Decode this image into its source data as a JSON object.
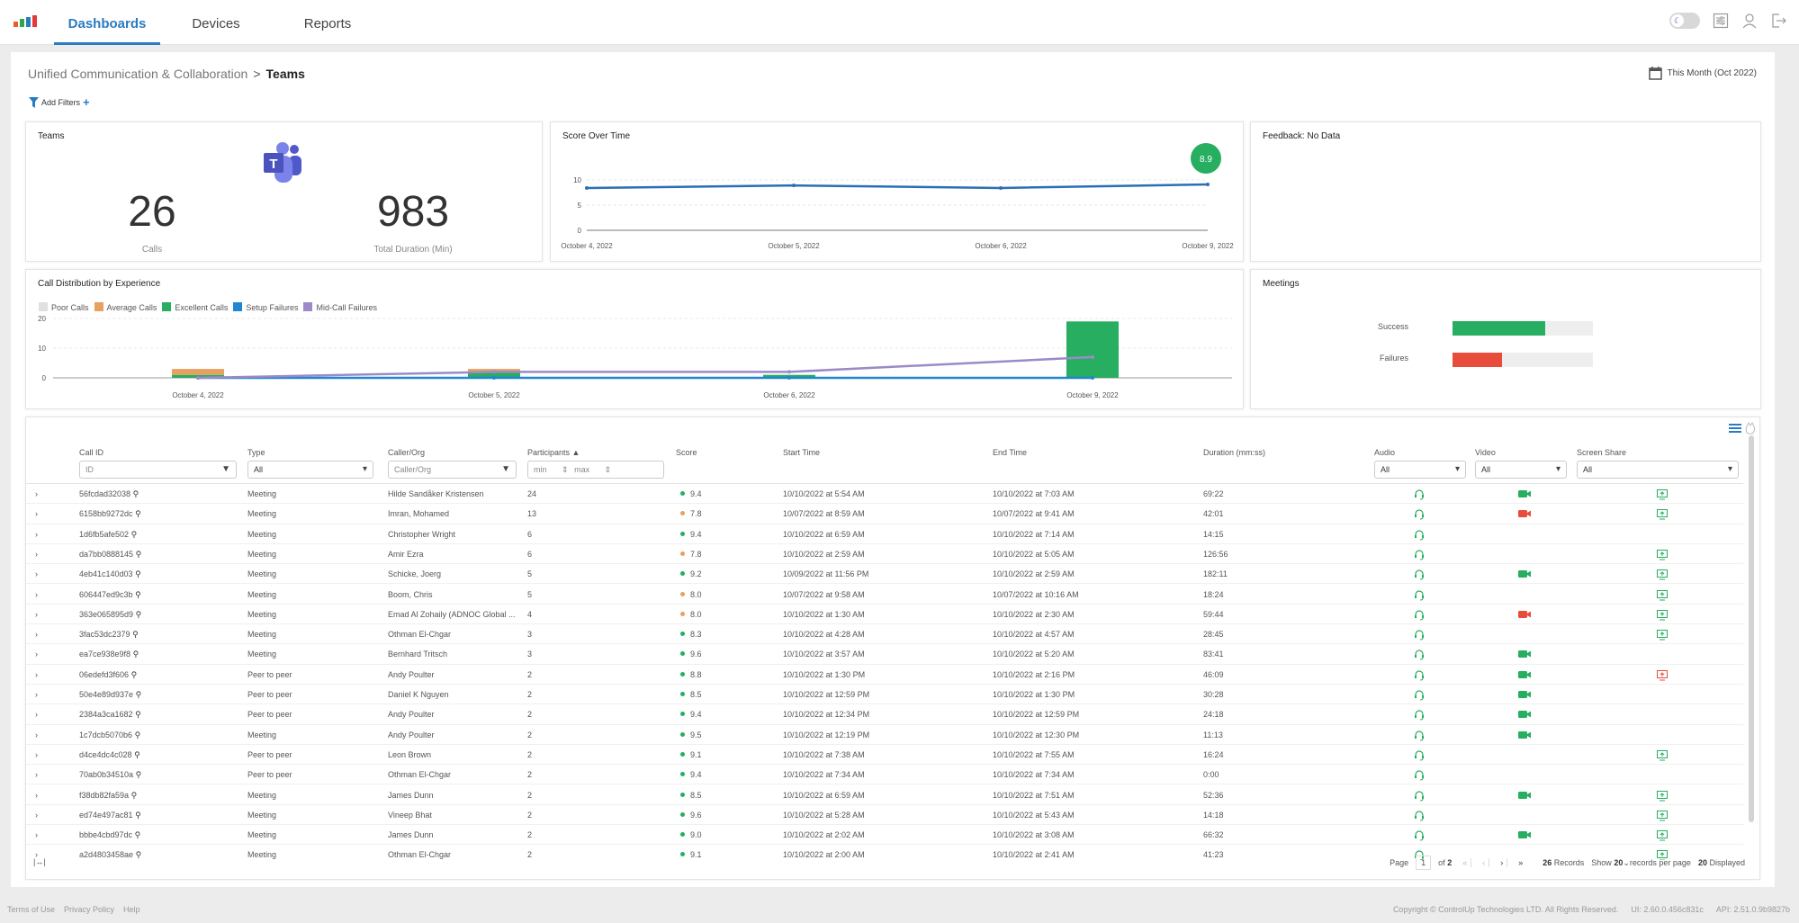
{
  "nav": {
    "tabs": [
      {
        "label": "Dashboards",
        "active": true
      },
      {
        "label": "Devices",
        "active": false
      },
      {
        "label": "Reports",
        "active": false
      }
    ],
    "icons": [
      "theme-toggle",
      "settings-sliders-icon",
      "user-icon",
      "logout-icon"
    ]
  },
  "breadcrumb": {
    "parent": "Unified Communication & Collaboration",
    "separator": ">",
    "current": "Teams"
  },
  "filters": {
    "add_label": "Add Filters",
    "add_icon": "+"
  },
  "date_range": "This Month (Oct 2022)",
  "teams_card": {
    "title": "Teams",
    "calls_value": "26",
    "calls_label": "Calls",
    "duration_value": "983",
    "duration_label": "Total Duration (Min)"
  },
  "score_card": {
    "title": "Score Over Time",
    "badge": "8.9",
    "badge_color": "#27ae60",
    "line_color": "#2a6fb5"
  },
  "feedback_card": {
    "title": "Feedback: No Data"
  },
  "distribution_card": {
    "title": "Call Distribution by Experience"
  },
  "meetings_card": {
    "title": "Meetings",
    "bars": [
      {
        "label": "Success",
        "fraction": 0.66,
        "color": "#27ae60"
      },
      {
        "label": "Failures",
        "fraction": 0.35,
        "color": "#e74c3c"
      }
    ]
  },
  "chart_data": [
    {
      "type": "line",
      "title": "Score Over Time",
      "x": [
        "October 4, 2022",
        "October 5, 2022",
        "October 6, 2022",
        "October 9, 2022"
      ],
      "series": [
        {
          "name": "Score",
          "values": [
            8.4,
            8.9,
            8.4,
            9.1
          ]
        }
      ],
      "ylim": [
        0,
        10
      ],
      "yticks": [
        0,
        5,
        10
      ],
      "grid": true,
      "annotation": "8.9"
    },
    {
      "type": "bar",
      "title": "Call Distribution by Experience",
      "categories": [
        "October 4, 2022",
        "October 5, 2022",
        "October 6, 2022",
        "October 9, 2022"
      ],
      "series": [
        {
          "name": "Poor Calls",
          "kind": "bar",
          "color": "#e0e0e0",
          "values": [
            0,
            0,
            0,
            0
          ]
        },
        {
          "name": "Average Calls",
          "kind": "bar",
          "color": "#e8a060",
          "values": [
            2,
            1,
            0,
            0
          ]
        },
        {
          "name": "Excellent Calls",
          "kind": "bar",
          "color": "#27ae60",
          "values": [
            1,
            2,
            1,
            19
          ]
        },
        {
          "name": "Setup Failures",
          "kind": "line",
          "color": "#1f86d1",
          "values": [
            0,
            0,
            0,
            0
          ]
        },
        {
          "name": "Mid-Call Failures",
          "kind": "line",
          "color": "#9b8ac7",
          "values": [
            0,
            2,
            2,
            7
          ]
        }
      ],
      "ylim": [
        0,
        20
      ],
      "yticks": [
        0,
        10,
        20
      ],
      "legend": "top-left",
      "grid": true
    }
  ],
  "table": {
    "columns": {
      "call_id": "Call ID",
      "type": "Type",
      "caller": "Caller/Org",
      "participants": "Participants ▲",
      "score": "Score",
      "start": "Start Time",
      "end": "End Time",
      "duration": "Duration (mm:ss)",
      "audio": "Audio",
      "video": "Video",
      "screen": "Screen Share"
    },
    "filters": {
      "call_id_placeholder": "ID",
      "type_value": "All",
      "caller_placeholder": "Caller/Org",
      "min_placeholder": "min",
      "max_placeholder": "max",
      "audio_value": "All",
      "video_value": "All",
      "screen_value": "All"
    },
    "rows": [
      {
        "id": "56fcdad32038",
        "type": "Meeting",
        "caller": "Hilde Sandåker Kristensen",
        "participants": "24",
        "score": "9.4",
        "score_color": "#27ae60",
        "start": "10/10/2022 at 5:54 AM",
        "end": "10/10/2022 at 7:03 AM",
        "duration": "69:22",
        "audio": "green",
        "video": "green",
        "screen": "green"
      },
      {
        "id": "6158bb9272dc",
        "type": "Meeting",
        "caller": "Imran, Mohamed",
        "participants": "13",
        "score": "7.8",
        "score_color": "#e8a060",
        "start": "10/07/2022 at 8:59 AM",
        "end": "10/07/2022 at 9:41 AM",
        "duration": "42:01",
        "audio": "green",
        "video": "red",
        "screen": "green"
      },
      {
        "id": "1d6fb5afe502",
        "type": "Meeting",
        "caller": "Christopher Wright",
        "participants": "6",
        "score": "9.4",
        "score_color": "#27ae60",
        "start": "10/10/2022 at 6:59 AM",
        "end": "10/10/2022 at 7:14 AM",
        "duration": "14:15",
        "audio": "green",
        "video": "",
        "screen": ""
      },
      {
        "id": "da7bb0888145",
        "type": "Meeting",
        "caller": "Amir Ezra",
        "participants": "6",
        "score": "7.8",
        "score_color": "#e8a060",
        "start": "10/10/2022 at 2:59 AM",
        "end": "10/10/2022 at 5:05 AM",
        "duration": "126:56",
        "audio": "green",
        "video": "",
        "screen": "green"
      },
      {
        "id": "4eb41c140d03",
        "type": "Meeting",
        "caller": "Schicke, Joerg",
        "participants": "5",
        "score": "9.2",
        "score_color": "#27ae60",
        "start": "10/09/2022 at 11:56 PM",
        "end": "10/10/2022 at 2:59 AM",
        "duration": "182:11",
        "audio": "green",
        "video": "green",
        "screen": "green"
      },
      {
        "id": "606447ed9c3b",
        "type": "Meeting",
        "caller": "Boom, Chris",
        "participants": "5",
        "score": "8.0",
        "score_color": "#e8a060",
        "start": "10/07/2022 at 9:58 AM",
        "end": "10/07/2022 at 10:16 AM",
        "duration": "18:24",
        "audio": "green",
        "video": "",
        "screen": "green"
      },
      {
        "id": "363e065895d9",
        "type": "Meeting",
        "caller": "Emad Al Zohaily (ADNOC Global ...",
        "participants": "4",
        "score": "8.0",
        "score_color": "#e8a060",
        "start": "10/10/2022 at 1:30 AM",
        "end": "10/10/2022 at 2:30 AM",
        "duration": "59:44",
        "audio": "green",
        "video": "red",
        "screen": "green"
      },
      {
        "id": "3fac53dc2379",
        "type": "Meeting",
        "caller": "Othman El-Chgar",
        "participants": "3",
        "score": "8.3",
        "score_color": "#27ae60",
        "start": "10/10/2022 at 4:28 AM",
        "end": "10/10/2022 at 4:57 AM",
        "duration": "28:45",
        "audio": "green",
        "video": "",
        "screen": "green"
      },
      {
        "id": "ea7ce938e9f8",
        "type": "Meeting",
        "caller": "Bernhard Tritsch",
        "participants": "3",
        "score": "9.6",
        "score_color": "#27ae60",
        "start": "10/10/2022 at 3:57 AM",
        "end": "10/10/2022 at 5:20 AM",
        "duration": "83:41",
        "audio": "green",
        "video": "green",
        "screen": ""
      },
      {
        "id": "06edefd3f606",
        "type": "Peer to peer",
        "caller": "Andy Poulter",
        "participants": "2",
        "score": "8.8",
        "score_color": "#27ae60",
        "start": "10/10/2022 at 1:30 PM",
        "end": "10/10/2022 at 2:16 PM",
        "duration": "46:09",
        "audio": "green",
        "video": "green",
        "screen": "red"
      },
      {
        "id": "50e4e89d937e",
        "type": "Peer to peer",
        "caller": "Daniel K Nguyen",
        "participants": "2",
        "score": "8.5",
        "score_color": "#27ae60",
        "start": "10/10/2022 at 12:59 PM",
        "end": "10/10/2022 at 1:30 PM",
        "duration": "30:28",
        "audio": "green",
        "video": "green",
        "screen": ""
      },
      {
        "id": "2384a3ca1682",
        "type": "Peer to peer",
        "caller": "Andy Poulter",
        "participants": "2",
        "score": "9.4",
        "score_color": "#27ae60",
        "start": "10/10/2022 at 12:34 PM",
        "end": "10/10/2022 at 12:59 PM",
        "duration": "24:18",
        "audio": "green",
        "video": "green",
        "screen": ""
      },
      {
        "id": "1c7dcb5070b6",
        "type": "Meeting",
        "caller": "Andy Poulter",
        "participants": "2",
        "score": "9.5",
        "score_color": "#27ae60",
        "start": "10/10/2022 at 12:19 PM",
        "end": "10/10/2022 at 12:30 PM",
        "duration": "11:13",
        "audio": "green",
        "video": "green",
        "screen": ""
      },
      {
        "id": "d4ce4dc4c028",
        "type": "Peer to peer",
        "caller": "Leon Brown",
        "participants": "2",
        "score": "9.1",
        "score_color": "#27ae60",
        "start": "10/10/2022 at 7:38 AM",
        "end": "10/10/2022 at 7:55 AM",
        "duration": "16:24",
        "audio": "green",
        "video": "",
        "screen": "green"
      },
      {
        "id": "70ab0b34510a",
        "type": "Peer to peer",
        "caller": "Othman El-Chgar",
        "participants": "2",
        "score": "9.4",
        "score_color": "#27ae60",
        "start": "10/10/2022 at 7:34 AM",
        "end": "10/10/2022 at 7:34 AM",
        "duration": "0:00",
        "audio": "green",
        "video": "",
        "screen": ""
      },
      {
        "id": "f38db82fa59a",
        "type": "Meeting",
        "caller": "James Dunn",
        "participants": "2",
        "score": "8.5",
        "score_color": "#27ae60",
        "start": "10/10/2022 at 6:59 AM",
        "end": "10/10/2022 at 7:51 AM",
        "duration": "52:36",
        "audio": "green",
        "video": "green",
        "screen": "green"
      },
      {
        "id": "ed74e497ac81",
        "type": "Meeting",
        "caller": "Vineep Bhat",
        "participants": "2",
        "score": "9.6",
        "score_color": "#27ae60",
        "start": "10/10/2022 at 5:28 AM",
        "end": "10/10/2022 at 5:43 AM",
        "duration": "14:18",
        "audio": "green",
        "video": "",
        "screen": "green"
      },
      {
        "id": "bbbe4cbd97dc",
        "type": "Meeting",
        "caller": "James Dunn",
        "participants": "2",
        "score": "9.0",
        "score_color": "#27ae60",
        "start": "10/10/2022 at 2:02 AM",
        "end": "10/10/2022 at 3:08 AM",
        "duration": "66:32",
        "audio": "green",
        "video": "green",
        "screen": "green"
      },
      {
        "id": "a2d4803458ae",
        "type": "Meeting",
        "caller": "Othman El-Chgar",
        "participants": "2",
        "score": "9.1",
        "score_color": "#27ae60",
        "start": "10/10/2022 at 2:00 AM",
        "end": "10/10/2022 at 2:41 AM",
        "duration": "41:23",
        "audio": "green",
        "video": "",
        "screen": "green"
      }
    ]
  },
  "pager": {
    "page_label": "Page",
    "page": "1",
    "of_label": "of",
    "total_pages": "2",
    "records_count": "26",
    "records_label": "Records",
    "show_label": "Show",
    "per_page": "20",
    "per_page_label": "records per page",
    "displayed_count": "20",
    "displayed_label": "Displayed"
  },
  "footer": {
    "links": [
      "Terms of Use",
      "Privacy Policy",
      "Help"
    ],
    "copyright": "Copyright © ControlUp Technologies LTD. All Rights Reserved.",
    "ui_version": "UI: 2.60.0.456c831c",
    "api_version": "API: 2.51.0.9b9827b"
  },
  "colors": {
    "accent": "#2a7bc0",
    "green": "#27ae60",
    "red": "#e74c3c",
    "orange": "#e8a060"
  }
}
